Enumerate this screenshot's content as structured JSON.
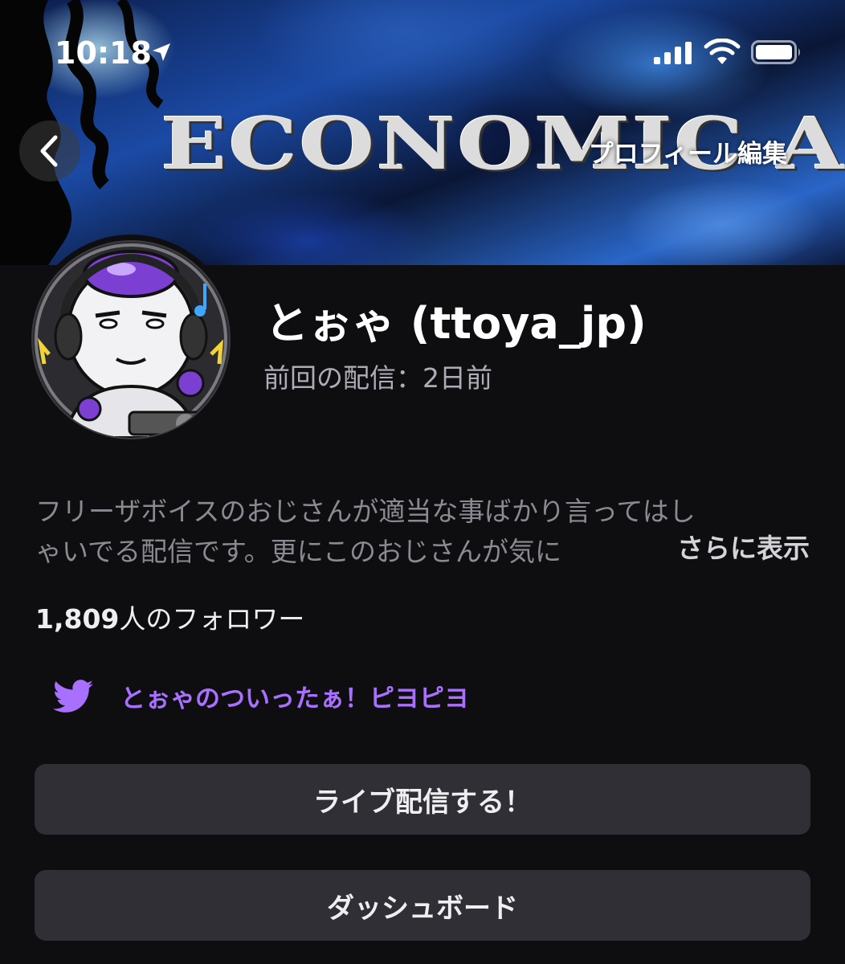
{
  "status_bar": {
    "time": "10:18",
    "icons": [
      "location-arrow-icon",
      "cellular-signal-icon",
      "wifi-icon",
      "battery-icon"
    ]
  },
  "banner": {
    "text": "ECONOMIC ANIM"
  },
  "nav": {
    "back_icon": "chevron-left-icon",
    "edit_profile_label": "プロフィール編集"
  },
  "profile": {
    "display_name": "とぉゃ (ttoya_jp)",
    "last_stream": "前回の配信：2日前",
    "bio_line1": "フリーザボイスのおじさんが適当な事ばかり言ってはし",
    "bio_line2": "ゃいでる配信です。更にこのおじさんが気に",
    "show_more_label": "さらに表示",
    "followers_count": "1,809",
    "followers_suffix": "人のフォロワー"
  },
  "social": {
    "icon": "twitter-icon",
    "label": "とぉゃのついったぁ！ピヨピヨ"
  },
  "buttons": {
    "go_live_label": "ライブ配信する！",
    "dashboard_label": "ダッシュボード"
  },
  "colors": {
    "accent": "#a970ff",
    "background": "#0e0e10",
    "button_bg": "#2f2f35"
  }
}
